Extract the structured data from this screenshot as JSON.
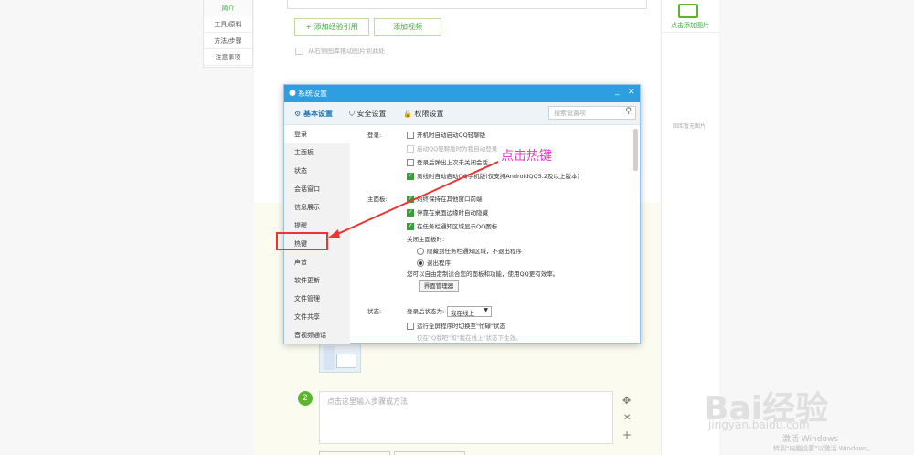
{
  "left_nav": [
    "简介",
    "工具/原料",
    "方法/步骤",
    "注意事项"
  ],
  "editor": {
    "add_ref": "+ 添加经验引用",
    "add_video": "添加视频",
    "drag_hint": "从右侧图库拖动图片到此处",
    "step_num": "2",
    "step_placeholder": "点击这里输入步骤或方法"
  },
  "right_panel": {
    "add_image": "点击添加图片",
    "no_image": "图库暂无图片"
  },
  "dialog": {
    "title": "系统设置",
    "tabs": [
      "基本设置",
      "安全设置",
      "权限设置"
    ],
    "search_placeholder": "搜索设置项",
    "side": [
      "登录",
      "主面板",
      "状态",
      "会话窗口",
      "信息展示",
      "提醒",
      "热键",
      "声音",
      "软件更新",
      "文件管理",
      "文件共享",
      "音视频通话"
    ],
    "login_label": "登录:",
    "login_opts": [
      "开机时自动启动QQ轻聊版",
      "启动QQ轻聊版时为我自动登录",
      "登录后弹出上次未关闭会话",
      "离线时自动启动QQ手机版(仅支持AndroidQQ5.2及以上版本)"
    ],
    "panel_label": "主面板:",
    "panel_opts": [
      "始终保持在其他窗口前端",
      "停靠在桌面边缘时自动隐藏",
      "在任务栏通知区域显示QQ图标"
    ],
    "close_label": "关闭主面板时:",
    "close_opts": [
      "隐藏到任务栏通知区域，不退出程序",
      "退出程序"
    ],
    "custom_text": "您可以自由定制适合您的面板和功能，使用QQ更有效率。",
    "manager_btn": "界面管理器",
    "status_label": "状态:",
    "status_after_login": "登录后状态为:",
    "status_value": "我在线上",
    "fullscreen": "运行全屏程序时切换至\"忙碌\"状态",
    "fullscreen_note": "仅在\"Q我吧\"和\"我在线上\"状态下生效。"
  },
  "annotation": "点击热键",
  "watermark": {
    "brand": "Bai经验",
    "url": "jingyan.baidu.com"
  },
  "activation": {
    "line1": "激活 Windows",
    "line2": "转到\"电脑设置\"以激活 Windows。"
  }
}
